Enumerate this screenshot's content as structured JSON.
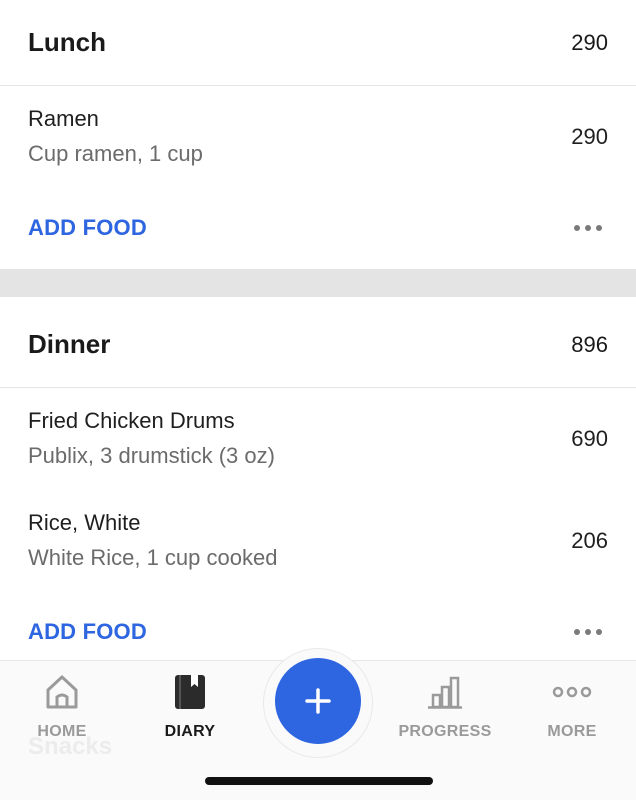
{
  "meals": {
    "lunch": {
      "title": "Lunch",
      "total": "290",
      "items": [
        {
          "name": "Ramen",
          "description": "Cup ramen, 1 cup",
          "calories": "290"
        }
      ],
      "add_label": "ADD FOOD"
    },
    "dinner": {
      "title": "Dinner",
      "total": "896",
      "items": [
        {
          "name": "Fried Chicken Drums",
          "description": "Publix, 3 drumstick (3 oz)",
          "calories": "690"
        },
        {
          "name": "Rice, White",
          "description": "White Rice, 1 cup cooked",
          "calories": "206"
        }
      ],
      "add_label": "ADD FOOD"
    },
    "snacks": {
      "title": "Snacks"
    }
  },
  "tabbar": {
    "tabs": [
      {
        "label": "HOME",
        "icon": "home-icon",
        "active": false
      },
      {
        "label": "DIARY",
        "icon": "diary-icon",
        "active": true
      },
      {
        "label": "PROGRESS",
        "icon": "progress-icon",
        "active": false
      },
      {
        "label": "MORE",
        "icon": "more-icon",
        "active": false
      }
    ],
    "fab_icon": "plus-icon"
  },
  "colors": {
    "accent": "#2e65e0",
    "inactive_tab": "#9a9a9a",
    "divider": "#e4e4e4"
  }
}
